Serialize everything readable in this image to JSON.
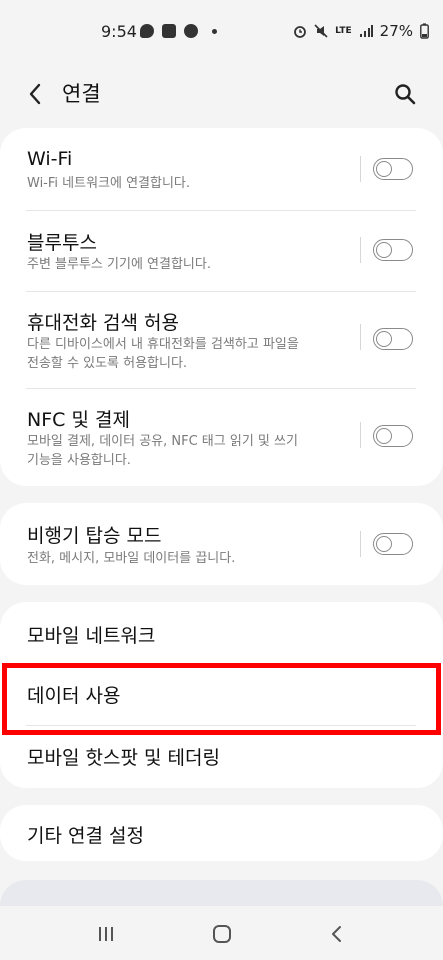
{
  "status_bar": {
    "time": "9:54",
    "battery": "27%",
    "network": "LTE",
    "left_icons": [
      "talk-icon",
      "gallery-icon",
      "face-icon",
      "dot-icon"
    ],
    "right_icons": [
      "alarm-icon",
      "mute-icon",
      "lte-icon",
      "signal-icon"
    ]
  },
  "header": {
    "title": "연결",
    "back_icon": "back-arrow-icon",
    "search_icon": "search-icon"
  },
  "groups": [
    {
      "items": [
        {
          "title": "Wi-Fi",
          "subtitle": [
            "Wi-Fi 네트워크에 연결합니다."
          ],
          "toggle": false
        },
        {
          "title": "블루투스",
          "subtitle": [
            "주변 블루투스 기기에 연결합니다."
          ],
          "toggle": false
        },
        {
          "title": "휴대전화 검색 허용",
          "subtitle": [
            "다른 디바이스에서 내 휴대전화를 검색하고 파일을",
            "전송할 수 있도록 허용합니다."
          ],
          "toggle": false
        },
        {
          "title": "NFC 및 결제",
          "subtitle": [
            "모바일 결제, 데이터 공유, NFC 태그 읽기 및 쓰기",
            "기능을 사용합니다."
          ],
          "toggle": false
        }
      ]
    },
    {
      "items": [
        {
          "title": "비행기 탑승 모드",
          "subtitle": [
            "전화, 메시지, 모바일 데이터를 끕니다."
          ],
          "toggle": false
        }
      ]
    },
    {
      "items": [
        {
          "title": "모바일 네트워크"
        },
        {
          "title": "데이터 사용"
        },
        {
          "title": "모바일 핫스팟 및 테더링"
        }
      ]
    },
    {
      "items": [
        {
          "title": "기타 연결 설정"
        }
      ]
    }
  ],
  "nav_bar": {
    "recent_icon": "recent-apps-icon",
    "home_icon": "home-icon",
    "back_icon": "nav-back-icon"
  },
  "colors": {
    "background": "#f4f4f4",
    "card": "#ffffff",
    "highlight": "#ff0000",
    "subtitle": "#7a7a7a"
  }
}
